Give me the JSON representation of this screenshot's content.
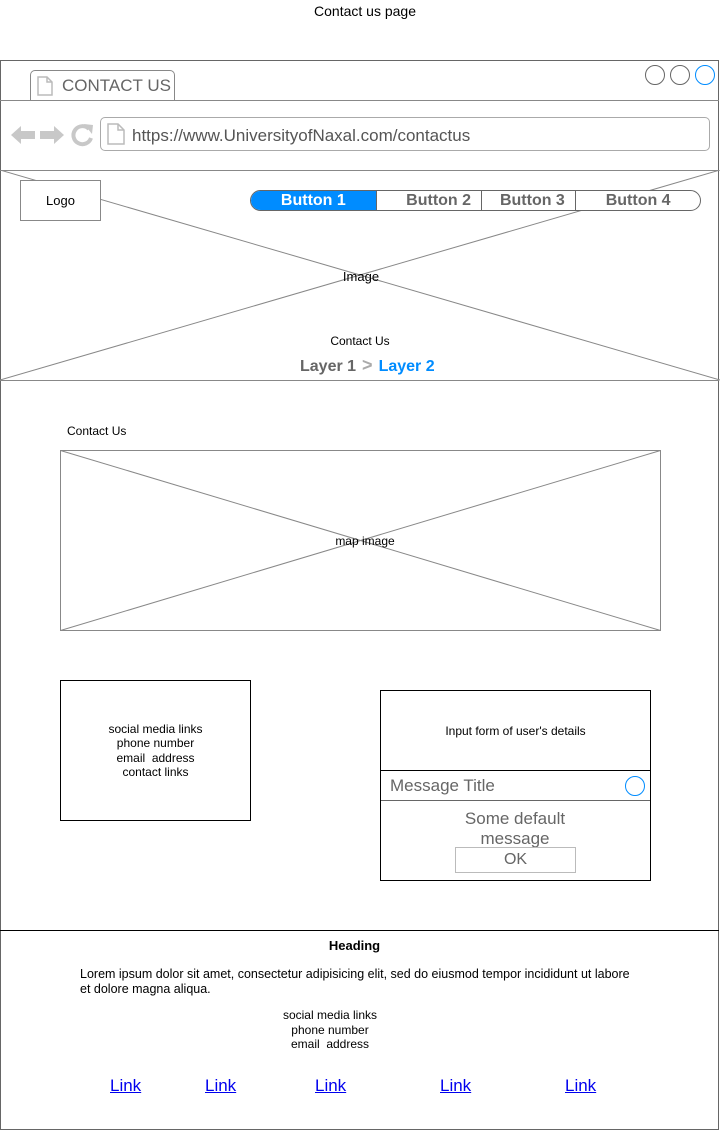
{
  "page_caption": "Contact us page",
  "browser": {
    "tab_title": "CONTACT US",
    "url": "https://www.UniversityofNaxal.com/contactus"
  },
  "hero": {
    "logo": "Logo",
    "nav_buttons": [
      "Button 1",
      "Button 2",
      "Button 3",
      "Button 4"
    ],
    "active_button": "Button 1",
    "image_label": "Image",
    "title": "Contact Us",
    "breadcrumb": [
      "Layer 1",
      "Layer 2"
    ],
    "accent_color": "#008cff"
  },
  "main": {
    "section_title": "Contact Us",
    "map_label": "map image",
    "info_box": [
      "social media links",
      "phone number",
      "email  address",
      "contact links"
    ],
    "form_label": "Input form of user's details",
    "dialog": {
      "title": "Message Title",
      "message": "Some default message",
      "ok_label": "OK"
    }
  },
  "footer": {
    "heading": "Heading",
    "paragraph": "Lorem ipsum dolor sit amet, consectetur adipisicing elit, sed do eiusmod tempor incididunt ut labore et dolore magna aliqua.",
    "contact_lines": [
      "social media links",
      "phone number",
      "email  address"
    ],
    "links": [
      "Link",
      "Link",
      "Link",
      "Link",
      "Link"
    ]
  }
}
